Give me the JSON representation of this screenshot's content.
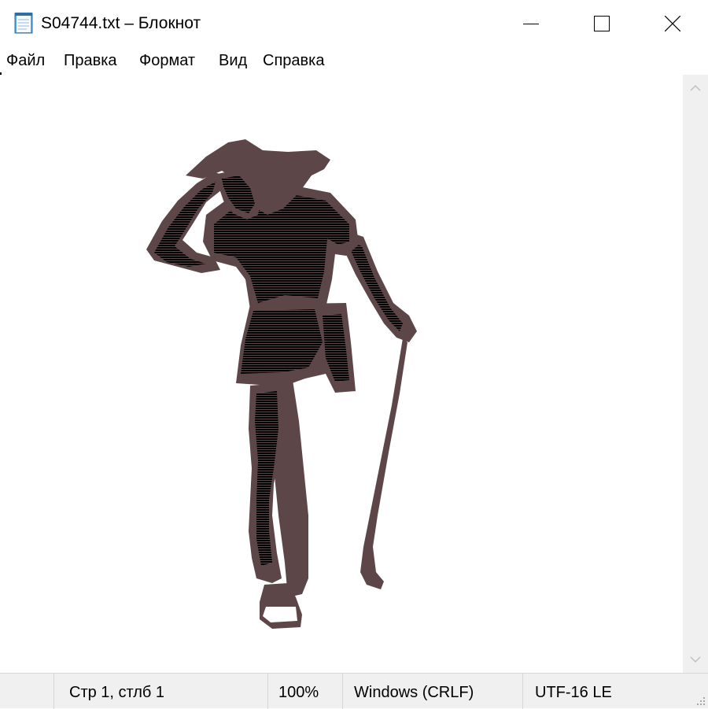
{
  "window": {
    "title": "S04744.txt – Блокнот",
    "app_icon": "notepad-icon",
    "controls": {
      "minimize_icon": "minimize-icon",
      "maximize_icon": "maximize-icon",
      "close_icon": "close-icon"
    }
  },
  "menu": {
    "items": [
      "Файл",
      "Правка",
      "Формат",
      "Вид",
      "Справка"
    ]
  },
  "editor": {
    "content_image": "golfer-ascii-art"
  },
  "scrollbar": {
    "up_icon": "chevron-up-icon",
    "down_icon": "chevron-down-icon"
  },
  "statusbar": {
    "position": "Стр 1, стлб 1",
    "zoom": "100%",
    "line_endings": "Windows (CRLF)",
    "encoding": "UTF-16 LE",
    "grip_icon": "resize-grip-icon"
  },
  "colors": {
    "dark_brown": "#5c4648",
    "shirt_green": "#9ccfa3",
    "skin_tan": "#9c9274",
    "shorts_beige": "#cfc6a3",
    "status_bg": "#f0f0f0",
    "scrollbar_bg": "#f0f0f0"
  }
}
